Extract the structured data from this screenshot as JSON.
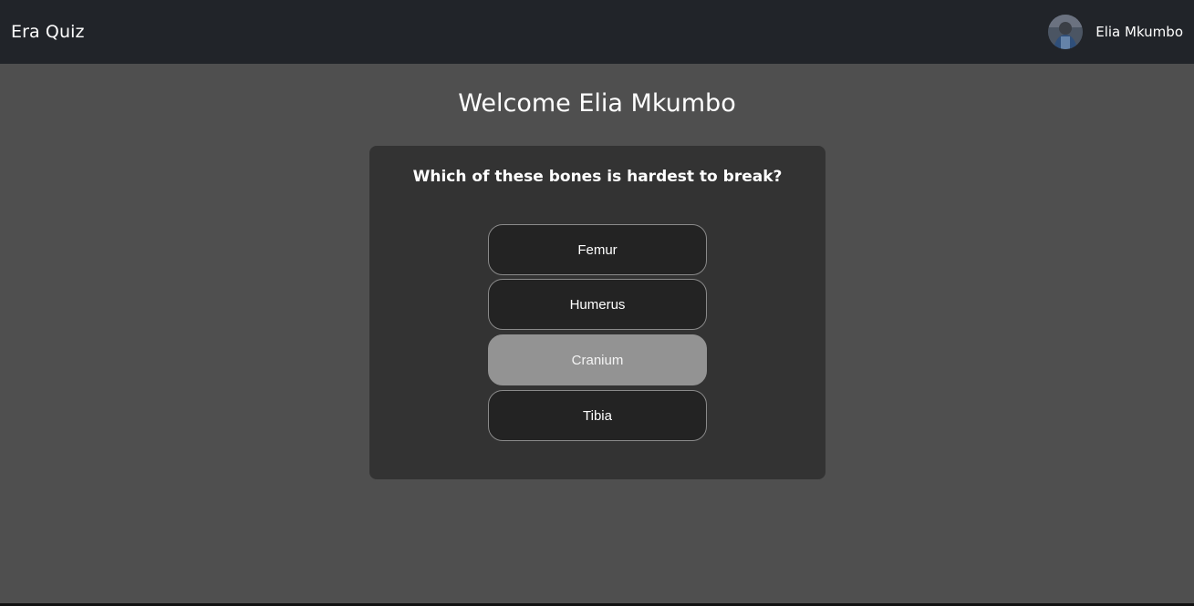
{
  "navbar": {
    "brand": "Era Quiz",
    "user_name": "Elia Mkumbo",
    "avatar_icon": "user-avatar-photo",
    "background": "#212429"
  },
  "main": {
    "welcome": "Welcome Elia Mkumbo",
    "background": "#4f4f4f"
  },
  "quiz": {
    "question": "Which of these bones is hardest to break?",
    "options": [
      {
        "label": "Femur",
        "selected": false
      },
      {
        "label": "Humerus",
        "selected": false
      },
      {
        "label": "Cranium",
        "selected": true
      },
      {
        "label": "Tibia",
        "selected": false
      }
    ],
    "selected_color": "#939393",
    "card_background": "#333333"
  }
}
